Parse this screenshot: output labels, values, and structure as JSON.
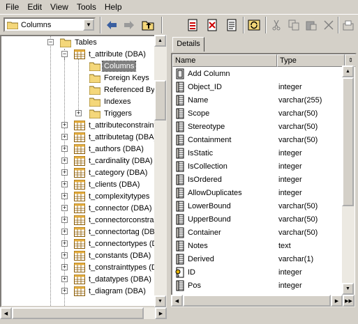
{
  "menu": [
    "File",
    "Edit",
    "View",
    "Tools",
    "Help"
  ],
  "toolbar": {
    "combo_value": "Columns"
  },
  "tree": {
    "root_label": "Tables",
    "table_label": "t_attribute (DBA)",
    "children": [
      "Columns",
      "Foreign Keys",
      "Referenced By",
      "Indexes",
      "Triggers"
    ],
    "selected_child": "Columns",
    "siblings": [
      "t_attributeconstraints",
      "t_attributetag (DBA)",
      "t_authors (DBA)",
      "t_cardinality (DBA)",
      "t_category (DBA)",
      "t_clients (DBA)",
      "t_complexitytypes",
      "t_connector (DBA)",
      "t_connectorconstraints",
      "t_connectortag (DBA)",
      "t_connectortypes (DBA)",
      "t_constants (DBA)",
      "t_constrainttypes (DBA)",
      "t_datatypes (DBA)",
      "t_diagram (DBA)"
    ]
  },
  "details": {
    "tab_label": "Details",
    "headers": {
      "name": "Name",
      "type": "Type"
    },
    "add_column_label": "Add Column",
    "rows": [
      {
        "name": "Object_ID",
        "type": "integer",
        "icon": "column-icon"
      },
      {
        "name": "Name",
        "type": "varchar(255)",
        "icon": "column-icon"
      },
      {
        "name": "Scope",
        "type": "varchar(50)",
        "icon": "column-icon"
      },
      {
        "name": "Stereotype",
        "type": "varchar(50)",
        "icon": "column-icon"
      },
      {
        "name": "Containment",
        "type": "varchar(50)",
        "icon": "column-icon"
      },
      {
        "name": "IsStatic",
        "type": "integer",
        "icon": "column-icon"
      },
      {
        "name": "IsCollection",
        "type": "integer",
        "icon": "column-icon"
      },
      {
        "name": "IsOrdered",
        "type": "integer",
        "icon": "column-icon"
      },
      {
        "name": "AllowDuplicates",
        "type": "integer",
        "icon": "column-icon"
      },
      {
        "name": "LowerBound",
        "type": "varchar(50)",
        "icon": "column-icon"
      },
      {
        "name": "UpperBound",
        "type": "varchar(50)",
        "icon": "column-icon"
      },
      {
        "name": "Container",
        "type": "varchar(50)",
        "icon": "column-icon"
      },
      {
        "name": "Notes",
        "type": "text",
        "icon": "column-icon"
      },
      {
        "name": "Derived",
        "type": "varchar(1)",
        "icon": "column-icon"
      },
      {
        "name": "ID",
        "type": "integer",
        "icon": "key-column-icon"
      },
      {
        "name": "Pos",
        "type": "integer",
        "icon": "column-icon"
      }
    ]
  },
  "colors": {
    "chrome": "#d4d0c8",
    "selection": "#808080",
    "folder": "#f4d77a",
    "table_icon": "#e8b040"
  }
}
